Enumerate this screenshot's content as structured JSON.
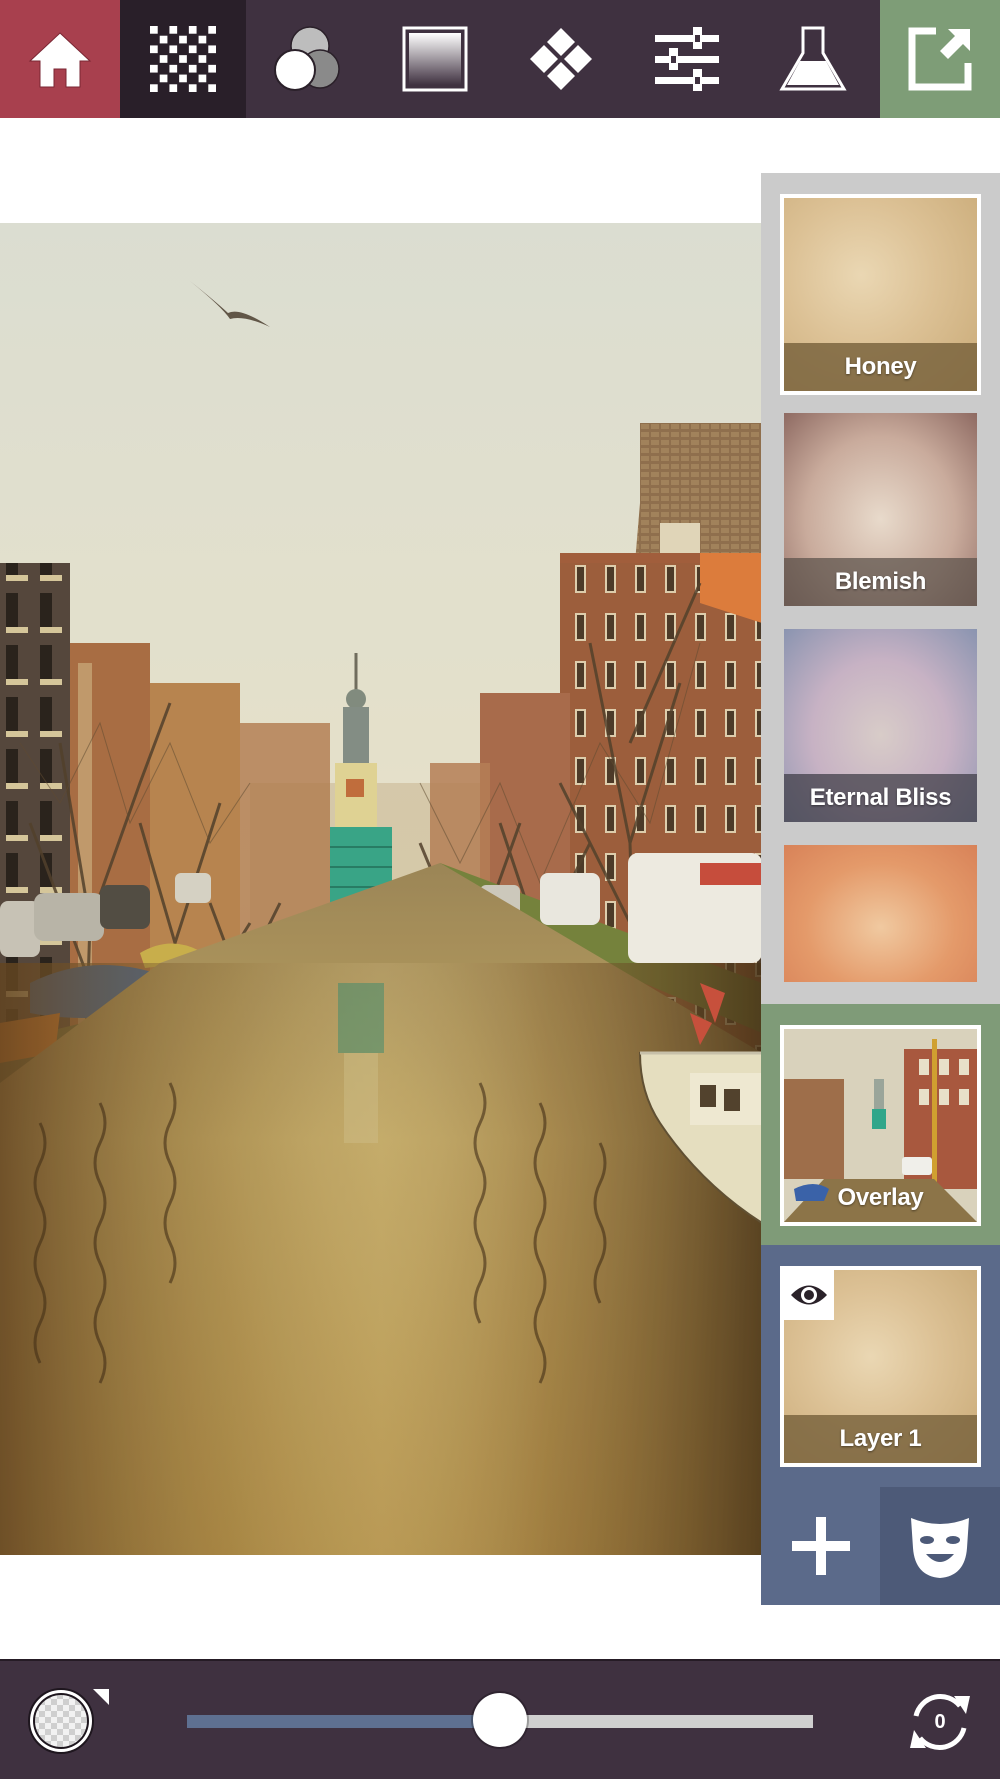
{
  "toolbar": {
    "items": [
      {
        "id": "home",
        "icon": "home-icon",
        "state": "accent"
      },
      {
        "id": "textures",
        "icon": "checkerboard-icon",
        "state": "active"
      },
      {
        "id": "blend",
        "icon": "color-circles-icon",
        "state": "normal"
      },
      {
        "id": "gradient",
        "icon": "gradient-square-icon",
        "state": "normal"
      },
      {
        "id": "geometry",
        "icon": "diamond-tiles-icon",
        "state": "normal"
      },
      {
        "id": "adjust",
        "icon": "sliders-icon",
        "state": "normal"
      },
      {
        "id": "lab",
        "icon": "flask-icon",
        "state": "normal"
      },
      {
        "id": "export",
        "icon": "export-icon",
        "state": "accent"
      }
    ],
    "colors": {
      "bar": "#3f3140",
      "home": "#a8404e",
      "active": "#291f29",
      "export": "#7e9d77"
    }
  },
  "textures": [
    {
      "name": "Honey",
      "selected": true
    },
    {
      "name": "Blemish",
      "selected": false
    },
    {
      "name": "Eternal Bliss",
      "selected": false
    },
    {
      "name": "",
      "selected": false
    }
  ],
  "layers": {
    "overlay": {
      "label": "Overlay"
    },
    "layer1": {
      "label": "Layer 1",
      "visibility_icon": "eye-icon"
    },
    "add_icon": "plus-icon",
    "mask_icon": "mask-icon"
  },
  "bottom": {
    "blend_icon": "transparency-circle-icon",
    "opacity_slider": {
      "value": 0.5,
      "min": 0,
      "max": 1
    },
    "reset_count": "0"
  }
}
